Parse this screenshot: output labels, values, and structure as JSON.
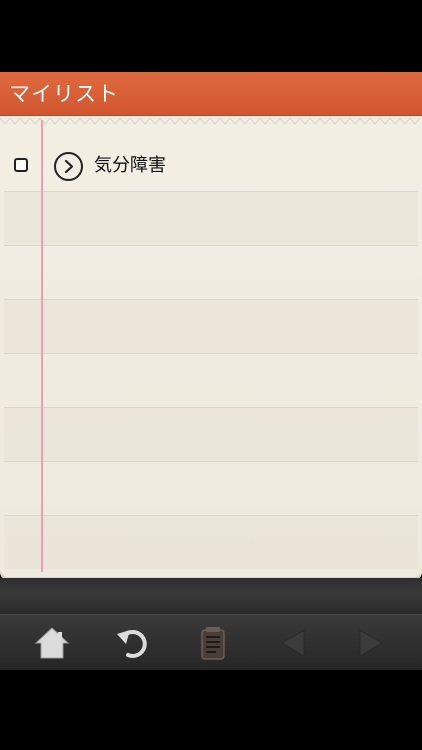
{
  "header": {
    "title": "マイリスト"
  },
  "list": {
    "items": [
      {
        "label": "気分障害",
        "checked": false,
        "disclosure_icon": "chevron-right-circle-icon"
      }
    ]
  },
  "toolbar": {
    "icons": [
      "home-icon",
      "refresh-icon",
      "notepad-icon",
      "back-arrow-icon",
      "forward-arrow-icon"
    ]
  },
  "colors": {
    "header": "#d95e35",
    "paper": "#f1ede2",
    "margin_line": "#e8a1b7",
    "toolbar": "#2f2f2f"
  }
}
